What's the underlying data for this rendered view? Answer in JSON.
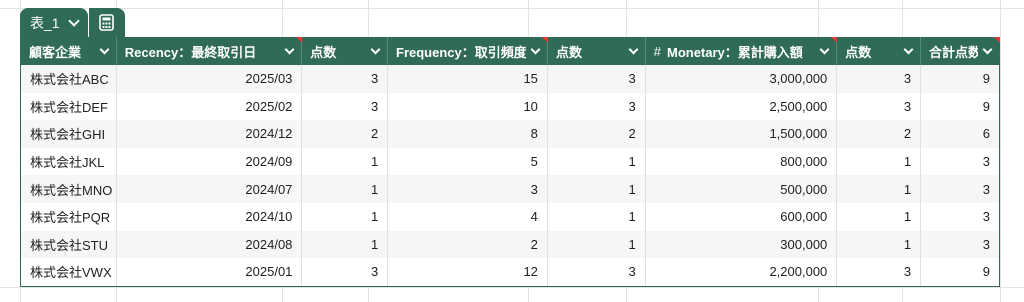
{
  "table_tab": {
    "name": "表_1",
    "calc_icon": "calculator-icon"
  },
  "columns": [
    {
      "label": "顧客企業",
      "type": "text",
      "has_hash": false
    },
    {
      "label": "Recency：最終取引日",
      "type": "num",
      "has_hash": false
    },
    {
      "label": "点数",
      "type": "num",
      "has_hash": false
    },
    {
      "label": "Frequency：取引頻度",
      "type": "num",
      "has_hash": false
    },
    {
      "label": "点数",
      "type": "num",
      "has_hash": false
    },
    {
      "label": "Monetary：累計購入額",
      "type": "num",
      "has_hash": true
    },
    {
      "label": "点数",
      "type": "num",
      "has_hash": false
    },
    {
      "label": "合計点数",
      "type": "num",
      "has_hash": false
    }
  ],
  "hash_symbol": "#",
  "rows": [
    [
      "株式会社ABC",
      "2025/03",
      "3",
      "15",
      "3",
      "3,000,000",
      "3",
      "9"
    ],
    [
      "株式会社DEF",
      "2025/02",
      "3",
      "10",
      "3",
      "2,500,000",
      "3",
      "9"
    ],
    [
      "株式会社GHI",
      "2024/12",
      "2",
      "8",
      "2",
      "1,500,000",
      "2",
      "6"
    ],
    [
      "株式会社JKL",
      "2024/09",
      "1",
      "5",
      "1",
      "800,000",
      "1",
      "3"
    ],
    [
      "株式会社MNO",
      "2024/07",
      "1",
      "3",
      "1",
      "500,000",
      "1",
      "3"
    ],
    [
      "株式会社PQR",
      "2024/10",
      "1",
      "4",
      "1",
      "600,000",
      "1",
      "3"
    ],
    [
      "株式会社STU",
      "2024/08",
      "1",
      "2",
      "1",
      "300,000",
      "1",
      "3"
    ],
    [
      "株式会社VWX",
      "2025/01",
      "3",
      "12",
      "3",
      "2,200,000",
      "3",
      "9"
    ]
  ],
  "colors": {
    "header_bg": "#2f6b57",
    "note_marker": "#e53935",
    "row_alt": "#f5f7f6"
  }
}
